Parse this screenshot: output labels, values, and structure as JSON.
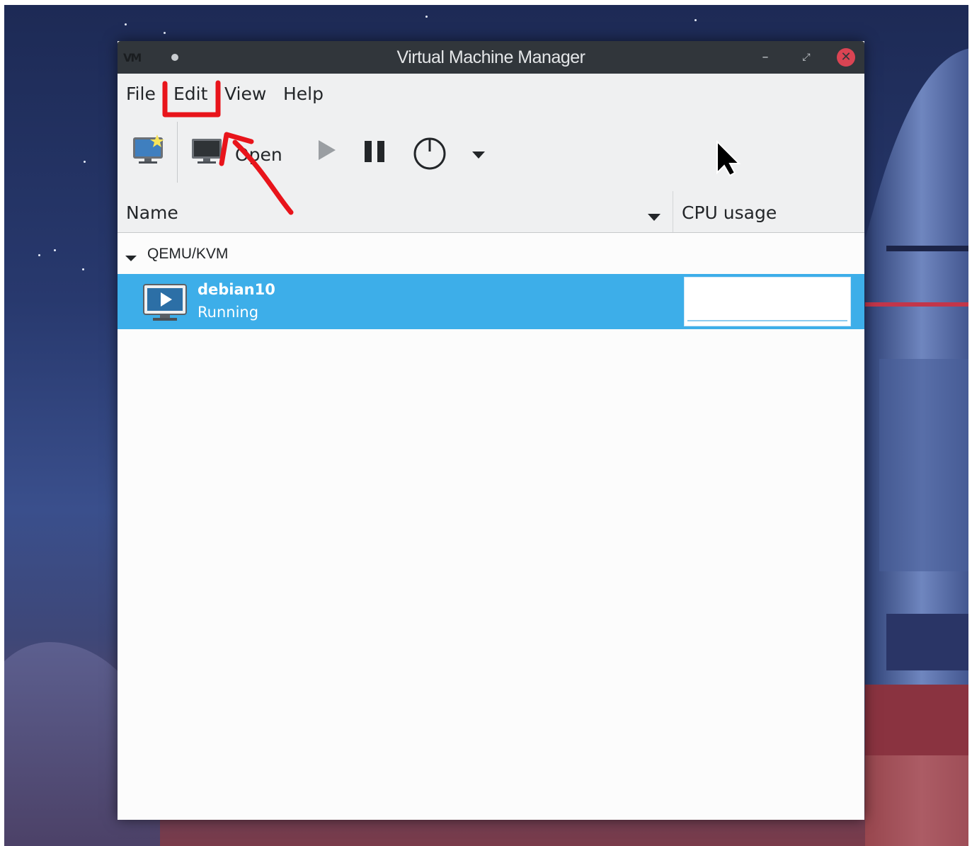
{
  "window": {
    "title": "Virtual Machine Manager",
    "app_logo": "VM",
    "controls": [
      "minimize-icon",
      "maximize-icon",
      "close-icon"
    ]
  },
  "menubar": {
    "items": [
      {
        "label": "File"
      },
      {
        "label": "Edit"
      },
      {
        "label": "View"
      },
      {
        "label": "Help"
      }
    ]
  },
  "toolbar": {
    "new_icon": "new-vm-icon",
    "open_label": "Open",
    "run_icon": "play-icon",
    "pause_icon": "pause-icon",
    "power_icon": "power-icon",
    "dropdown_icon": "chevron-down-icon"
  },
  "columns": {
    "name_label": "Name",
    "cpu_label": "CPU usage"
  },
  "connections": [
    {
      "label": "QEMU/KVM",
      "vms": [
        {
          "name": "debian10",
          "status": "Running",
          "selected": true
        }
      ]
    }
  ],
  "colors": {
    "selection": "#3daee9",
    "titlebar": "#31363b",
    "close_button": "#da4453",
    "annotation": "#e8141b"
  }
}
